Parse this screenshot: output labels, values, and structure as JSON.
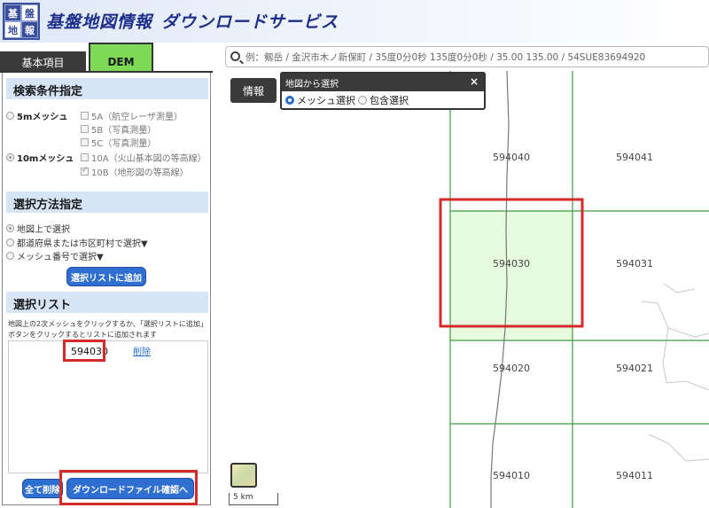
{
  "header": {
    "logo_chars": [
      "基",
      "盤",
      "地",
      "図",
      "情",
      "報"
    ],
    "title_main": "基盤地図情報",
    "title_sub": "ダウンロードサービス"
  },
  "tabs": [
    {
      "label": "基本項目",
      "active": false
    },
    {
      "label": "DEM",
      "active": true
    }
  ],
  "search": {
    "placeholder": "例：剱岳 / 金沢市木ノ新保町 / 35度0分0秒 135度0分0秒 / 35.00 135.00 / 54SUE83694920"
  },
  "search_conditions": {
    "heading": "検索条件指定",
    "mesh5": {
      "label": "5mメッシュ",
      "selected": false
    },
    "mesh5_options": [
      "5A（航空レーザ測量）",
      "5B（写真測量）",
      "5C（写真測量）"
    ],
    "mesh10": {
      "label": "10mメッシュ",
      "selected": true
    },
    "mesh10_options": [
      "10A（火山基本図の等高線）",
      "10B（地形図の等高線）"
    ]
  },
  "selection_method": {
    "heading": "選択方法指定",
    "options": [
      "地図上で選択",
      "都道府県または市区町村で選択▼",
      "メッシュ番号で選択▼"
    ],
    "add_button": "選択リストに追加"
  },
  "selection_list": {
    "heading": "選択リスト",
    "note": "地図上の2次メッシュをクリックするか、「選択リストに追加」ボタンをクリックするとリストに追加されます",
    "items": [
      {
        "code": "594030",
        "delete_label": "削除"
      }
    ],
    "clear_button": "全て削除",
    "download_button": "ダウンロードファイル確認へ"
  },
  "map": {
    "info_button": "情報",
    "popup": {
      "title": "地図から選択",
      "close": "×",
      "options": [
        "メッシュ選択",
        "包含選択"
      ]
    },
    "mesh_labels": [
      "594040",
      "594041",
      "594030",
      "594031",
      "594020",
      "594021",
      "594010",
      "594011"
    ],
    "selected_mesh": "594030",
    "scale_label": "5 km"
  },
  "colors": {
    "tab_active": "#7ed957",
    "section_header": "#d6e4f5",
    "button_blue": "#2f6fd1",
    "highlight_red": "#d62a2a",
    "mesh_grid": "#3f9a3f",
    "selected_mesh_fill": "#e6fbdd"
  }
}
